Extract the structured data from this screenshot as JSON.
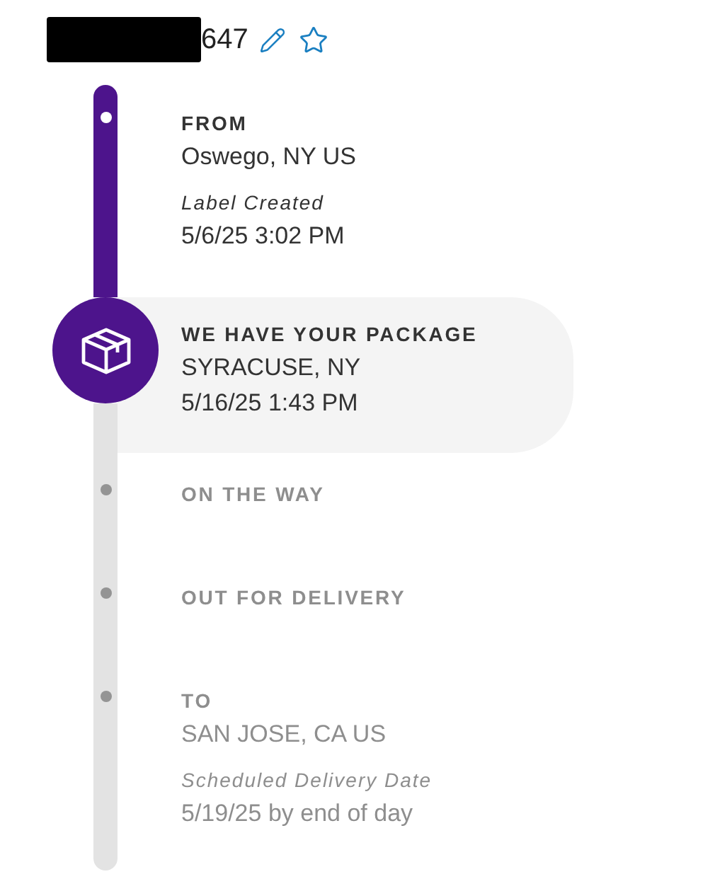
{
  "header": {
    "redacted": true,
    "tracking_number": "647"
  },
  "steps": [
    {
      "done": true,
      "current": false,
      "title": "FROM",
      "lines": [
        {
          "kind": "value",
          "text": "Oswego, NY US"
        },
        {
          "kind": "note",
          "text": "Label Created"
        },
        {
          "kind": "value",
          "text": "5/6/25 3:02 PM"
        }
      ]
    },
    {
      "done": false,
      "current": true,
      "title": "WE HAVE YOUR PACKAGE",
      "lines": [
        {
          "kind": "value",
          "text": "SYRACUSE, NY"
        },
        {
          "kind": "value",
          "text": "5/16/25 1:43 PM"
        }
      ]
    },
    {
      "done": false,
      "current": false,
      "title": "ON THE WAY"
    },
    {
      "done": false,
      "current": false,
      "title": "OUT FOR DELIVERY"
    },
    {
      "done": false,
      "current": false,
      "title": "TO",
      "lines": [
        {
          "kind": "value",
          "text": "SAN JOSE, CA US"
        },
        {
          "kind": "note",
          "text": "Scheduled Delivery Date"
        },
        {
          "kind": "value",
          "text": "5/19/25 by end of day"
        }
      ]
    }
  ]
}
